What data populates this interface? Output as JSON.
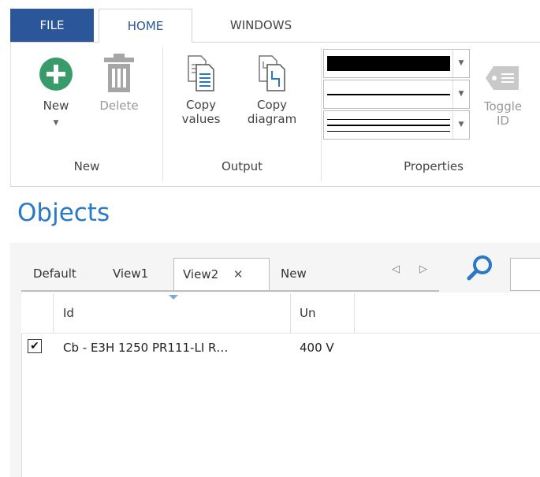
{
  "tabs": {
    "file": "FILE",
    "home": "HOME",
    "windows": "WINDOWS"
  },
  "ribbon": {
    "new_group": {
      "new_label": "New",
      "delete_label": "Delete",
      "group_label": "New"
    },
    "output_group": {
      "copy_values_line1": "Copy",
      "copy_values_line2": "values",
      "copy_diagram_line1": "Copy",
      "copy_diagram_line2": "diagram",
      "group_label": "Output"
    },
    "properties_group": {
      "toggle_line1": "Toggle",
      "toggle_line2": "ID",
      "group_label": "Properties"
    }
  },
  "heading": "Objects",
  "view_tabs": {
    "default": "Default",
    "view1": "View1",
    "view2": "View2",
    "new": "New",
    "close": "✕"
  },
  "table": {
    "headers": {
      "id": "Id",
      "un": "Un"
    },
    "rows": [
      {
        "checked": true,
        "id": "Cb - E3H 1250 PR111-LI R…",
        "un": "400 V"
      }
    ]
  },
  "icons": {
    "new": "plus-circle-icon",
    "delete": "trash-icon",
    "copy_values": "copy-doc-icon",
    "copy_diagram": "copy-diagram-icon",
    "toggle_id": "tag-icon",
    "search": "search-icon"
  },
  "colors": {
    "file_tab": "#2b579a",
    "accent": "#2b79c6",
    "new_icon": "#3a9b6a"
  }
}
